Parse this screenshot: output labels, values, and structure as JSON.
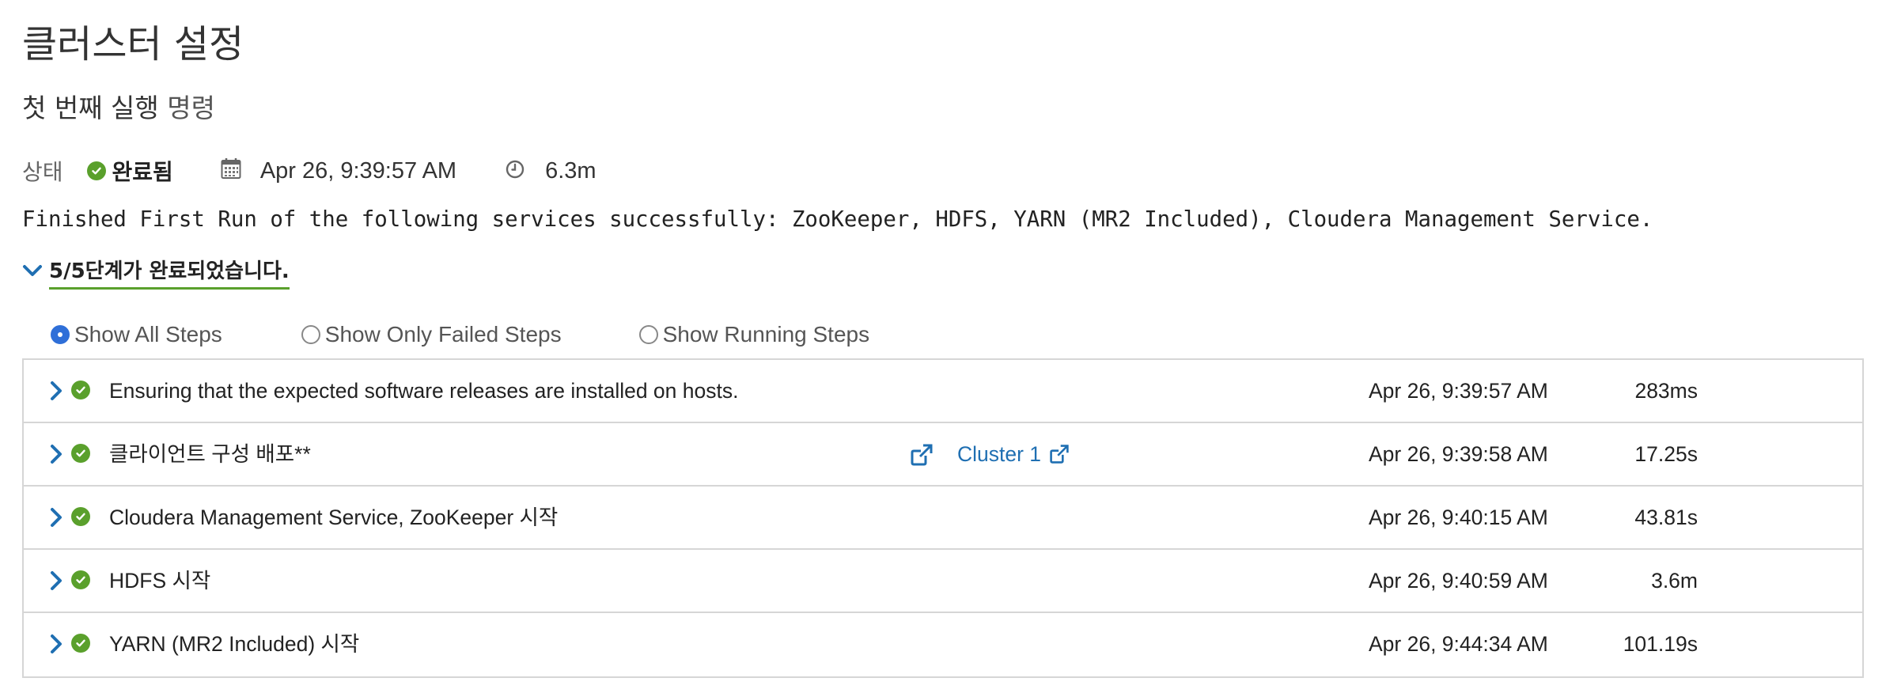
{
  "page": {
    "title": "클러스터 설정",
    "subtitle_main": "첫 번째 실행",
    "subtitle_suffix": "명령"
  },
  "status": {
    "label": "상태",
    "value": "완료됨",
    "date": "Apr 26, 9:39:57 AM",
    "duration": "6.3m",
    "icons": [
      "check-circle-icon",
      "calendar-icon",
      "clock-icon"
    ],
    "success_color": "#5aa02c"
  },
  "message": "Finished First Run of the following services successfully: ZooKeeper, HDFS, YARN (MR2 Included), Cloudera Management Service.",
  "steps_summary": "5/5단계가 완료되었습니다.",
  "filters": [
    {
      "label": "Show All Steps",
      "selected": true
    },
    {
      "label": "Show Only Failed Steps",
      "selected": false
    },
    {
      "label": "Show Running Steps",
      "selected": false
    }
  ],
  "steps": [
    {
      "name": "Ensuring that the expected software releases are installed on hosts.",
      "time": "Apr 26, 9:39:57 AM",
      "duration": "283ms",
      "status": "success"
    },
    {
      "name": "클라이언트 구성 배포**",
      "link": "Cluster 1",
      "time": "Apr 26, 9:39:58 AM",
      "duration": "17.25s",
      "status": "success"
    },
    {
      "name": "Cloudera Management Service, ZooKeeper 시작",
      "time": "Apr 26, 9:40:15 AM",
      "duration": "43.81s",
      "status": "success"
    },
    {
      "name": "HDFS 시작",
      "time": "Apr 26, 9:40:59 AM",
      "duration": "3.6m",
      "status": "success"
    },
    {
      "name": "YARN (MR2 Included) 시작",
      "time": "Apr 26, 9:44:34 AM",
      "duration": "101.19s",
      "status": "success"
    }
  ],
  "colors": {
    "accent_blue": "#1f6fb2",
    "radio_blue": "#2f6fd8",
    "border": "#d6d6d6"
  }
}
